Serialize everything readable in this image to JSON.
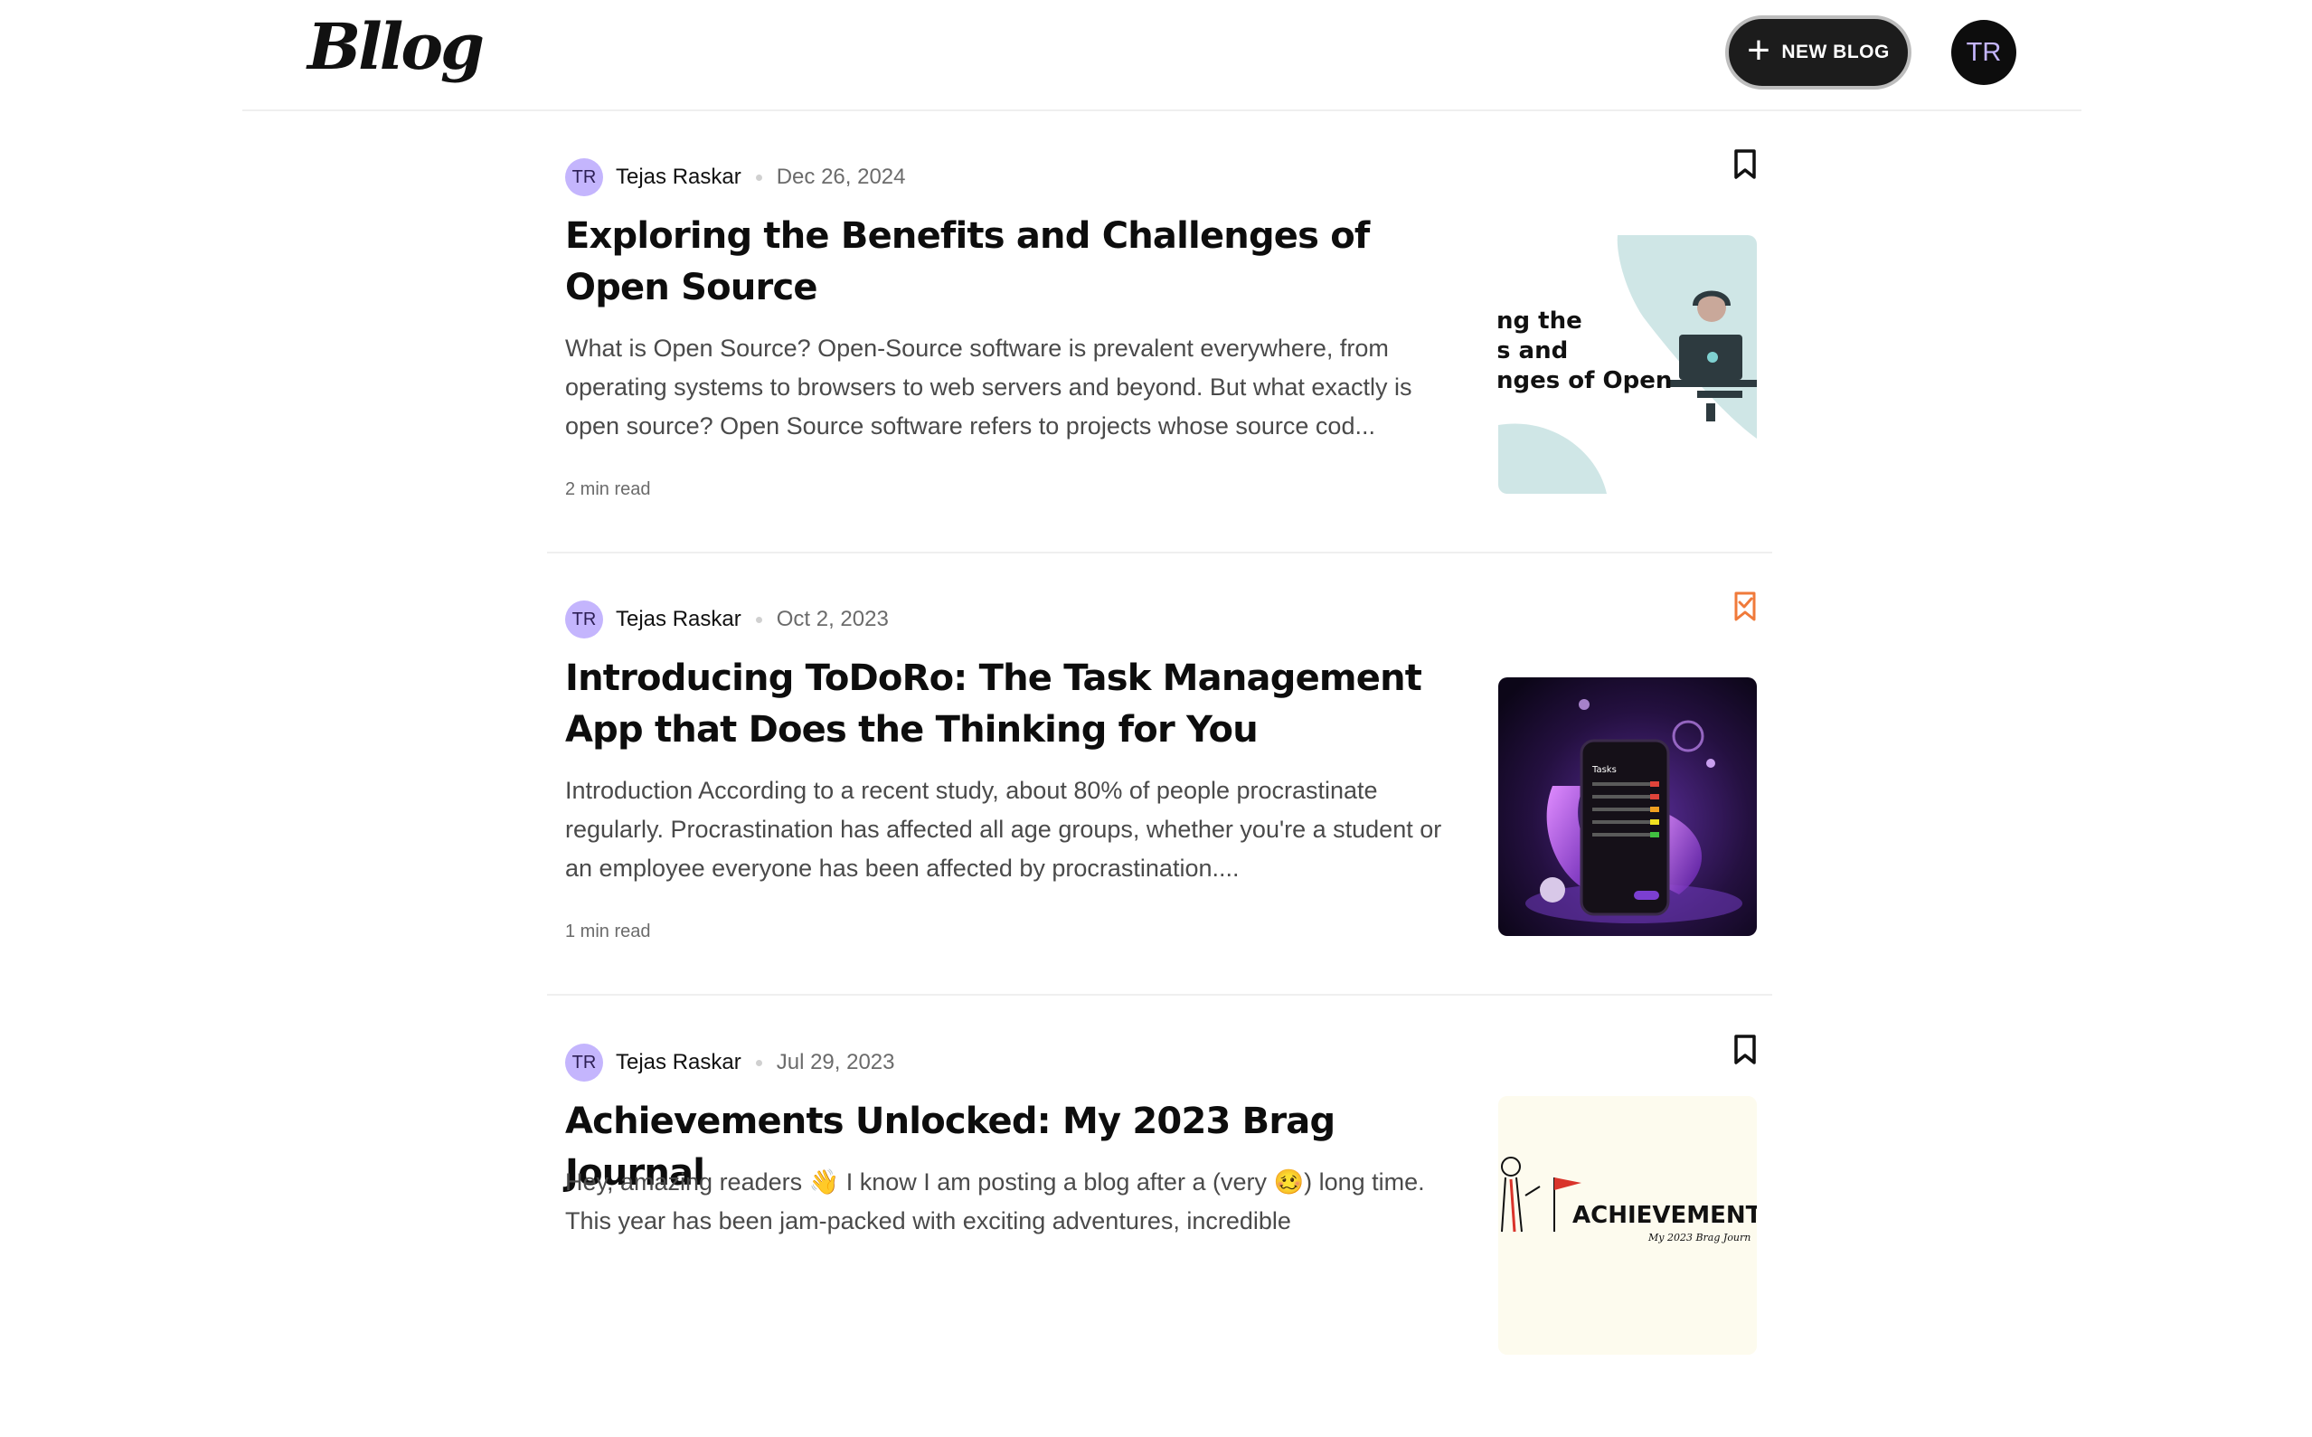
{
  "header": {
    "logo": "Bllog",
    "new_blog_label": "NEW BLOG",
    "new_blog_icon": "plus-icon",
    "user_initials": "TR"
  },
  "posts": [
    {
      "author_initials": "TR",
      "author": "Tejas Raskar",
      "date": "Dec 26, 2024",
      "title": "Exploring the Benefits and Challenges of Open Source",
      "excerpt": "What is Open Source? Open-Source software is prevalent everywhere, from operating systems to browsers to web servers and beyond. But what exactly is open source? Open Source software refers to projects whose source cod...",
      "read_time": "2 min read",
      "bookmark_icon": "bookmark-outline-icon",
      "bookmarked": false,
      "thumbnail_text": [
        "ng the",
        "s and",
        "nges of Open"
      ]
    },
    {
      "author_initials": "TR",
      "author": "Tejas Raskar",
      "date": "Oct 2, 2023",
      "title": "Introducing ToDoRo: The Task Management App that Does the Thinking for You",
      "excerpt": "Introduction According to a recent study, about 80% of people procrastinate regularly. Procrastination has affected all age groups, whether you're a student or an employee everyone has been affected by procrastination....",
      "read_time": "1 min read",
      "bookmark_icon": "bookmark-check-icon",
      "bookmarked": true,
      "thumbnail_text": [
        "Tasks"
      ]
    },
    {
      "author_initials": "TR",
      "author": "Tejas Raskar",
      "date": "Jul 29, 2023",
      "title": "Achievements Unlocked: My 2023 Brag Journal",
      "excerpt": "Hey, amazing readers 👋 I know I am posting a blog after a (very 🥴) long time. This year has been jam-packed with exciting adventures, incredible",
      "read_time": "",
      "bookmark_icon": "bookmark-outline-icon",
      "bookmarked": false,
      "thumbnail_text": [
        "ACHIEVEMENTS UN",
        "My 2023 Brag Journ"
      ]
    }
  ],
  "colors": {
    "accent_bookmarked": "#f07a3a",
    "avatar_bg": "#c4b5fd",
    "button_bg": "#1c1c1c"
  }
}
